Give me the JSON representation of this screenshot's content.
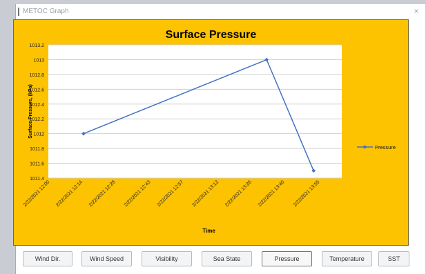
{
  "window": {
    "title": "METOC Graph",
    "close_glyph": "×"
  },
  "colors": {
    "chart_bg": "#fdc200",
    "plot_bg": "#ffffff",
    "series": "#4472c4",
    "grid": "#d0d0d0"
  },
  "chart_data": {
    "type": "line",
    "title": "Surface Pressure",
    "xlabel": "Time",
    "ylabel": "Surface Pressure, (kPa)",
    "ylim": [
      1011.4,
      1013.2
    ],
    "yticks": [
      "1013.2",
      "1013",
      "1012.8",
      "1012.6",
      "1012.4",
      "1012.2",
      "1012",
      "1011.8",
      "1011.6",
      "1011.4"
    ],
    "xticks": [
      "2/22/2021 12:00",
      "2/22/2021 12:14",
      "2/22/2021 12:28",
      "2/22/2021 12:43",
      "2/22/2021 12:57",
      "2/22/2021 13:12",
      "2/22/2021 13:26",
      "2/22/2021 13:40",
      "2/22/2021 13:55"
    ],
    "xlim": [
      "2/22/2021 12:00",
      "2/22/2021 14:05"
    ],
    "grid": true,
    "legend": "right",
    "series": [
      {
        "name": "Pressure",
        "x": [
          "2/22/2021 12:15",
          "2/22/2021 13:33",
          "2/22/2021 13:53"
        ],
        "values": [
          1012.0,
          1013.0,
          1011.5
        ]
      }
    ]
  },
  "buttons": [
    "Wind Dir.",
    "Wind Speed",
    "Visibility",
    "Sea State",
    "Pressure",
    "Temperature",
    "SST"
  ],
  "active_button": "Pressure"
}
